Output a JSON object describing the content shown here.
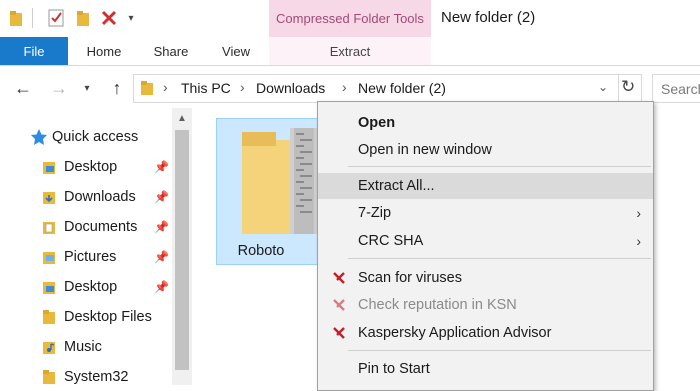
{
  "window": {
    "title": "New folder (2)"
  },
  "ribbon": {
    "context_tools_label": "Compressed Folder Tools",
    "tabs": [
      "File",
      "Home",
      "Share",
      "View",
      "Extract"
    ]
  },
  "address": {
    "crumbs": [
      "This PC",
      "Downloads",
      "New folder (2)"
    ],
    "search_placeholder": "Search"
  },
  "nav_pane": {
    "items": [
      {
        "label": "Quick access",
        "icon": "star-icon",
        "pinned": false
      },
      {
        "label": "Desktop",
        "icon": "desktop-folder-icon",
        "pinned": true
      },
      {
        "label": "Downloads",
        "icon": "downloads-folder-icon",
        "pinned": true
      },
      {
        "label": "Documents",
        "icon": "documents-folder-icon",
        "pinned": true
      },
      {
        "label": "Pictures",
        "icon": "pictures-folder-icon",
        "pinned": true
      },
      {
        "label": "Desktop",
        "icon": "desktop-folder-icon",
        "pinned": true
      },
      {
        "label": "Desktop Files",
        "icon": "folder-icon",
        "pinned": false
      },
      {
        "label": "Music",
        "icon": "music-folder-icon",
        "pinned": false
      },
      {
        "label": "System32",
        "icon": "folder-icon",
        "pinned": false
      }
    ]
  },
  "content": {
    "files": [
      {
        "name": "Roboto",
        "type": "compressed-folder"
      }
    ]
  },
  "context_menu": {
    "items": [
      {
        "label": "Open",
        "bold": true
      },
      {
        "label": "Open in new window"
      },
      {
        "label": "Extract All...",
        "highlighted": true
      },
      {
        "label": "7-Zip",
        "submenu": true
      },
      {
        "label": "CRC SHA",
        "submenu": true
      },
      {
        "label": "Scan for viruses",
        "icon": "kaspersky-icon"
      },
      {
        "label": "Check reputation in KSN",
        "icon": "kaspersky-icon",
        "disabled": true
      },
      {
        "label": "Kaspersky Application Advisor",
        "icon": "kaspersky-icon"
      },
      {
        "label": "Pin to Start"
      }
    ]
  },
  "colors": {
    "file_tab": "#1979ca",
    "context_tab": "#f6d8e6",
    "selection": "#cce8ff",
    "menu_highlight": "#dadada"
  }
}
